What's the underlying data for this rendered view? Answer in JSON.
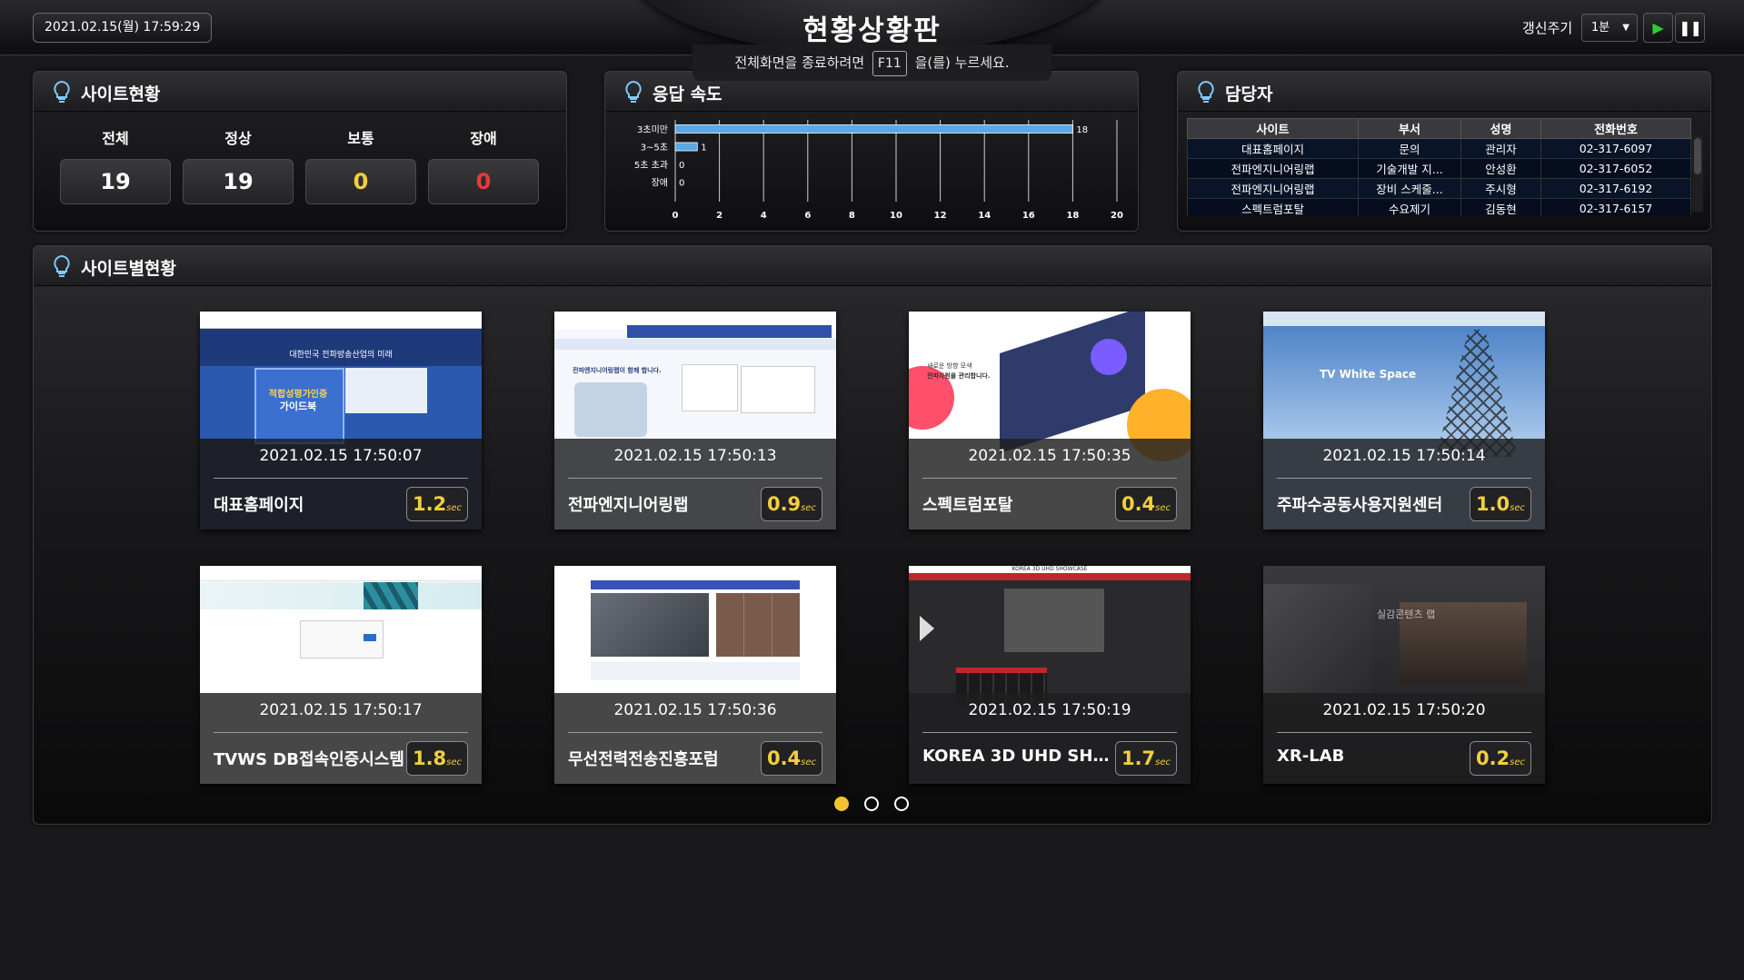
{
  "header": {
    "datetime": "2021.02.15(월) 17:59:29",
    "title": "현황상황판",
    "fullscreen_notice_pre": "전체화면을 종료하려면",
    "fullscreen_notice_key": "F11",
    "fullscreen_notice_post": "을(를) 누르세요.",
    "refresh_label": "갱신주기",
    "refresh_value": "1분"
  },
  "status_panel": {
    "title": "사이트현황",
    "items": [
      {
        "label": "전체",
        "value": "19",
        "color": "#ffffff"
      },
      {
        "label": "정상",
        "value": "19",
        "color": "#ffffff"
      },
      {
        "label": "보통",
        "value": "0",
        "color": "#f2cf3c"
      },
      {
        "label": "장애",
        "value": "0",
        "color": "#e83a3a"
      }
    ]
  },
  "speed_panel": {
    "title": "응답 속도"
  },
  "chart_data": {
    "type": "bar",
    "orientation": "horizontal",
    "categories": [
      "3초미만",
      "3~5초",
      "5초 초과",
      "장애"
    ],
    "values": [
      18,
      1,
      0,
      0
    ],
    "xlim": [
      0,
      20
    ],
    "xticks": [
      0,
      2,
      4,
      6,
      8,
      10,
      12,
      14,
      16,
      18,
      20
    ],
    "bar_color": "#5aa8e6",
    "grid": true
  },
  "contact_panel": {
    "title": "담당자",
    "headers": [
      "사이트",
      "부서",
      "성명",
      "전화번호"
    ],
    "rows": [
      [
        "대표홈페이지",
        "문의",
        "관리자",
        "02-317-6097"
      ],
      [
        "전파엔지니어링랩",
        "기술개발 지...",
        "안성환",
        "02-317-6052"
      ],
      [
        "전파엔지니어링랩",
        "장비 스케줄...",
        "주시형",
        "02-317-6192"
      ],
      [
        "스펙트럼포탈",
        "수요제기",
        "김동현",
        "02-317-6157"
      ]
    ]
  },
  "sites_panel": {
    "title": "사이트별현황",
    "speed_unit": "sec",
    "cards": [
      {
        "name": "대표홈페이지",
        "time": "2021.02.15 17:50:07",
        "speed": "1.2"
      },
      {
        "name": "전파엔지니어링랩",
        "time": "2021.02.15 17:50:13",
        "speed": "0.9"
      },
      {
        "name": "스펙트럼포탈",
        "time": "2021.02.15 17:50:35",
        "speed": "0.4"
      },
      {
        "name": "주파수공동사용지원센터",
        "time": "2021.02.15 17:50:14",
        "speed": "1.0"
      },
      {
        "name": "TVWS DB접속인증시스템",
        "time": "2021.02.15 17:50:17",
        "speed": "1.8"
      },
      {
        "name": "무선전력전송진흥포럼",
        "time": "2021.02.15 17:50:36",
        "speed": "0.4"
      },
      {
        "name": "KOREA 3D UHD SHOWC...",
        "time": "2021.02.15 17:50:19",
        "speed": "1.7"
      },
      {
        "name": "XR-LAB",
        "time": "2021.02.15 17:50:20",
        "speed": "0.2"
      }
    ],
    "pagination": {
      "pages": 3,
      "current": 1
    }
  },
  "thumbnail_texts": {
    "card1": {
      "line1": "대한민국 전파방송산업의 미래",
      "line2": "적합성평가인증",
      "line3": "가이드북"
    },
    "card2": {
      "line1": "전파엔지니어링랩이 함께 합니다."
    },
    "card3": {
      "line1": "새로운 방향 모색",
      "line2": "전파자원을 관리합니다."
    },
    "card4": {
      "line1": "TV White Space"
    },
    "card7": {
      "line1": "KOREA 3D UHD SHOWCASE"
    },
    "card8": {
      "line1": "실감콘텐츠 랩"
    }
  },
  "theme": {
    "accent_yellow": "#f2cf3c",
    "error_red": "#e83a3a",
    "play_green": "#2ecc31",
    "active_dot": "#f2c232"
  }
}
